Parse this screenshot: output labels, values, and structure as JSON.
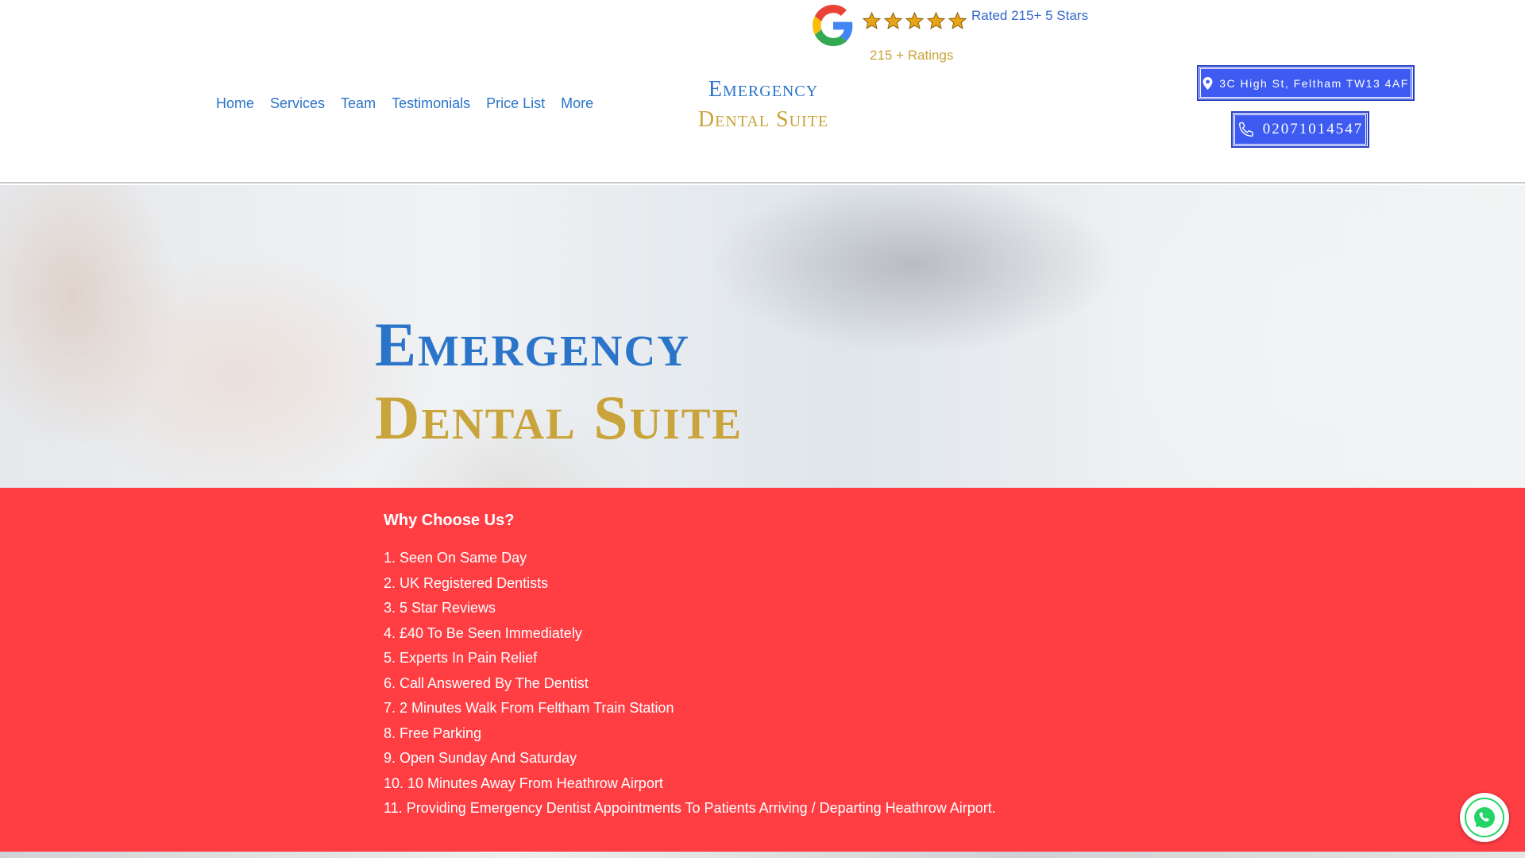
{
  "header": {
    "rating": {
      "rated_text": "Rated 215+ 5 Stars",
      "ratings_count": "215 + Ratings",
      "stars": 5,
      "star_color": "#e8a317",
      "google_colors": [
        "#4285f4",
        "#ea4335",
        "#fbbc05",
        "#34a853"
      ]
    },
    "nav": {
      "items": [
        {
          "label": "Home"
        },
        {
          "label": "Services"
        },
        {
          "label": "Team"
        },
        {
          "label": "Testimonials"
        },
        {
          "label": "Price List"
        },
        {
          "label": "More"
        }
      ]
    },
    "logo": {
      "line1": "Emergency",
      "line2": "Dental Suite"
    },
    "address_button": {
      "label": "3C High St, Feltham TW13 4AF",
      "icon": "map-pin-icon"
    },
    "phone_button": {
      "label": "02071014547",
      "icon": "phone-icon"
    }
  },
  "hero": {
    "title_line1": "Emergency",
    "title_line2": "Dental Suite"
  },
  "why_choose": {
    "title": "Why Choose Us?",
    "items": [
      "1. Seen On Same Day",
      "2. UK Registered Dentists",
      "3. 5 Star Reviews",
      "4. £40 To Be Seen Immediately",
      "5. Experts In Pain Relief",
      "6. Call Answered By The Dentist",
      "7. 2 Minutes Walk From Feltham Train Station",
      "8. Free Parking",
      "9. Open Sunday And Saturday",
      "10. 10 Minutes Away From Heathrow Airport",
      "11. Providing Emergency Dentist Appointments To Patients Arriving / Departing Heathrow Airport."
    ]
  },
  "floating": {
    "whatsapp_icon": "whatsapp-icon"
  },
  "colors": {
    "brand_blue": "#2a74c9",
    "brand_gold": "#c9a43a",
    "button_blue": "#3d5af1",
    "section_red": "#ff3e44",
    "whatsapp_green": "#25d366"
  }
}
